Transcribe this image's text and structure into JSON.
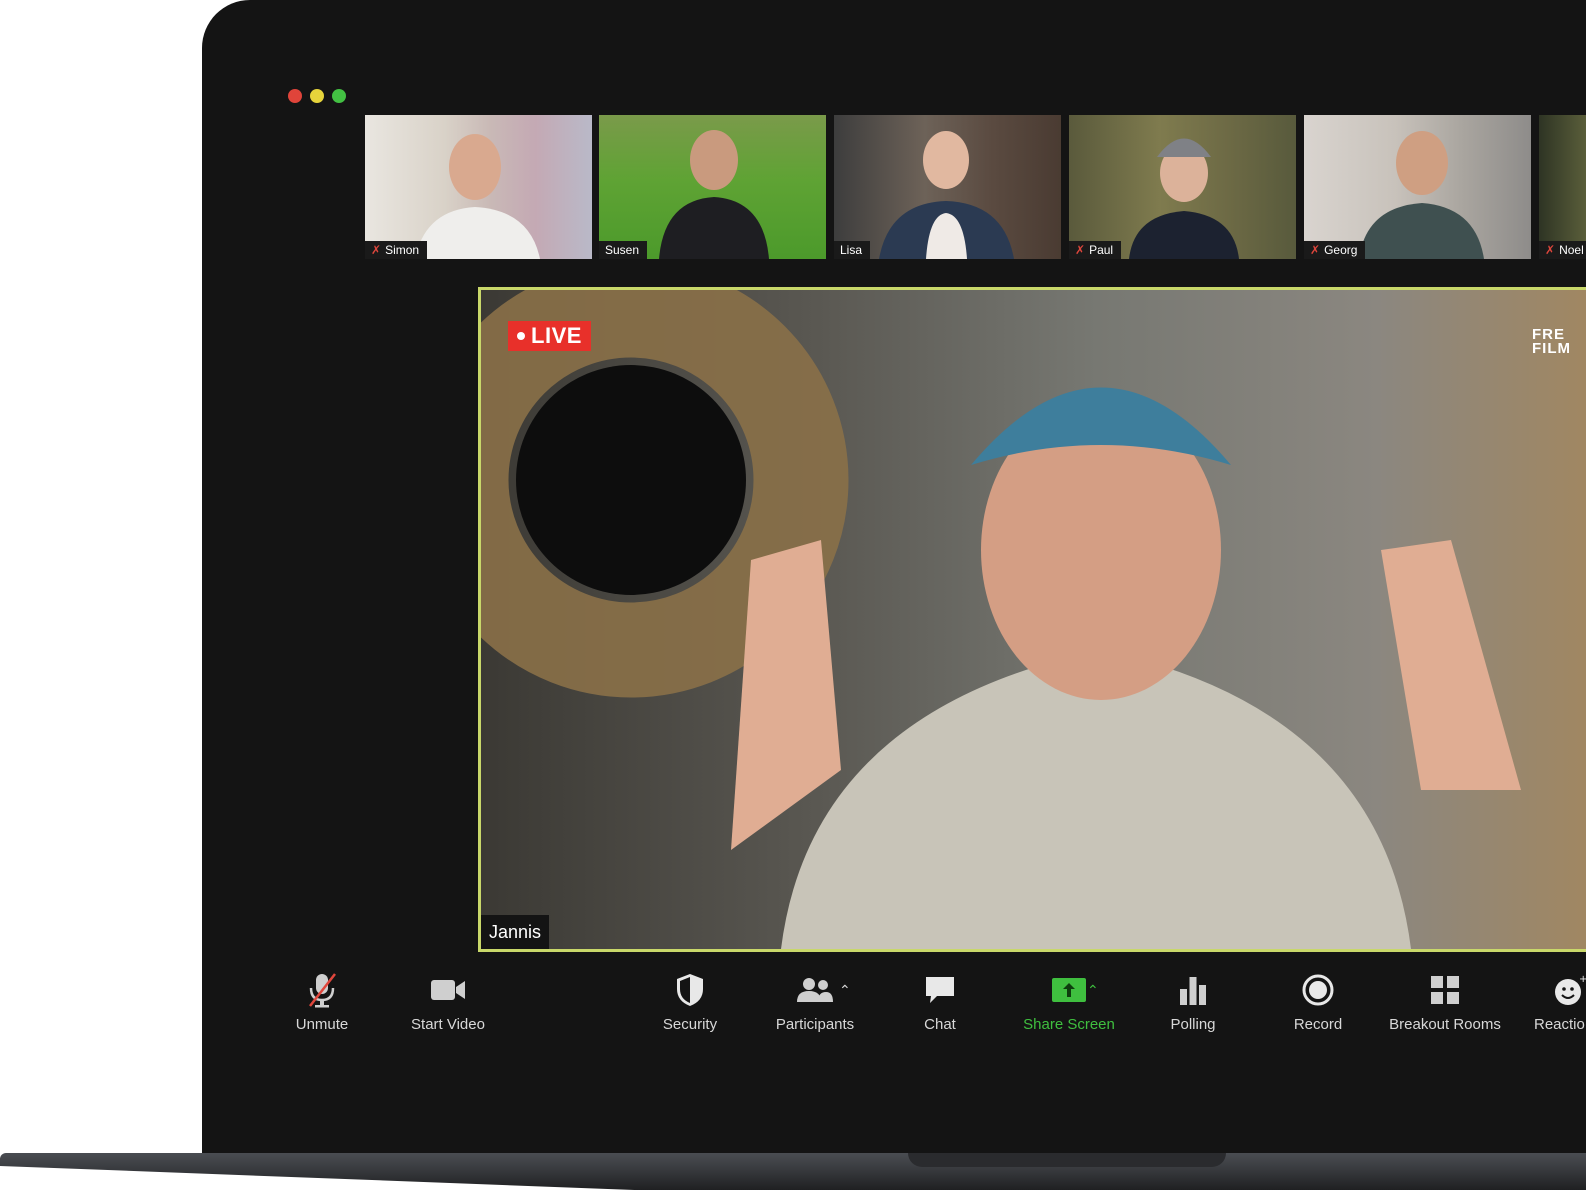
{
  "colors": {
    "window_bg": "#141414",
    "speaker_border": "#c9d86a",
    "live_red": "#e8302a",
    "share_green": "#3fbf3f",
    "close": "#e0443a",
    "minimize": "#e6d43b",
    "maximize": "#43c043"
  },
  "participants": [
    {
      "name": "Simon",
      "muted": true
    },
    {
      "name": "Susen",
      "muted": false
    },
    {
      "name": "Lisa",
      "muted": false
    },
    {
      "name": "Paul",
      "muted": true
    },
    {
      "name": "Georg",
      "muted": true
    },
    {
      "name": "Noel",
      "muted": true
    }
  ],
  "speaker": {
    "name": "Jannis",
    "live_label": "LIVE",
    "watermark_line1": "FRE",
    "watermark_line2": "FILM"
  },
  "toolbar": {
    "unmute": "Unmute",
    "start_video": "Start Video",
    "security": "Security",
    "participants": "Participants",
    "chat": "Chat",
    "share_screen": "Share Screen",
    "polling": "Polling",
    "record": "Record",
    "breakout_rooms": "Breakout Rooms",
    "reactions": "Reactio"
  }
}
